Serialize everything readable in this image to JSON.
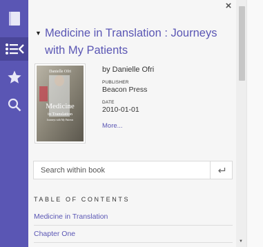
{
  "rail": {
    "items": [
      {
        "name": "book-icon",
        "active": false
      },
      {
        "name": "contents-list-icon",
        "active": true
      },
      {
        "name": "bookmark-star-icon",
        "active": false
      },
      {
        "name": "search-icon",
        "active": false
      }
    ]
  },
  "book": {
    "title": "Medicine in Translation : Journeys with My Patients",
    "author_line": "by Danielle Ofri",
    "publisher_label": "PUBLISHER",
    "publisher": "Beacon Press",
    "date_label": "DATE",
    "date": "2010-01-01",
    "more_label": "More...",
    "cover": {
      "author": "Danielle Ofri",
      "title_line1": "Medicine",
      "title_line2": "in Translation",
      "subtitle": "Journeys with My Patients"
    }
  },
  "search": {
    "placeholder": "Search within book",
    "submit_icon": "return-arrow-icon"
  },
  "toc": {
    "heading": "TABLE OF CONTENTS",
    "items": [
      "Medicine in Translation",
      "Chapter One"
    ]
  },
  "colors": {
    "accent": "#5a56b4",
    "rail_bg": "#5a56b4",
    "rail_active": "#4a4699",
    "panel_bg": "#f6f6f6"
  }
}
